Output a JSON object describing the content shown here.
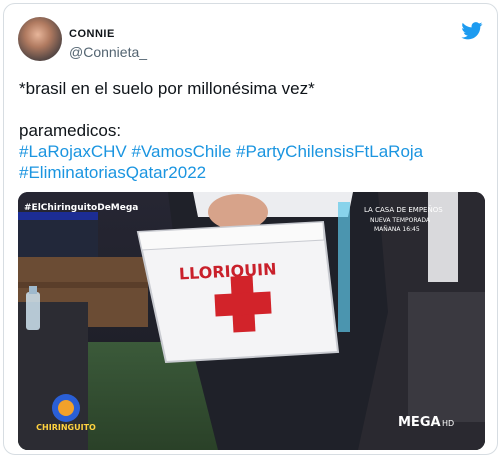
{
  "tweet": {
    "author": {
      "display_name": "CONNIE",
      "handle": "@Connieta_"
    },
    "text_line1": "*brasil en el suelo por millonésima vez*",
    "text_line2": "paramedicos:",
    "hashtags": [
      "#LaRojaxCHV",
      "#VamosChile",
      "#PartyChilensisFtLaRoja",
      "#EliminatoriasQatar2022"
    ],
    "brand_color": "#1d9bf0",
    "icons": [
      "twitter-bird-icon"
    ]
  },
  "media": {
    "hashtag_overlay": "#ElChiringuitoDeMega",
    "box_label": "LLORIQUIN",
    "promo_line1": "LA CASA DE EMPEÑOS",
    "promo_line2": "NUEVA TEMPORADA",
    "promo_line3": "MAÑANA 16:45",
    "show_logo": "CHIRINGUITO",
    "channel_logo": "MEGA",
    "channel_hd": "HD"
  }
}
